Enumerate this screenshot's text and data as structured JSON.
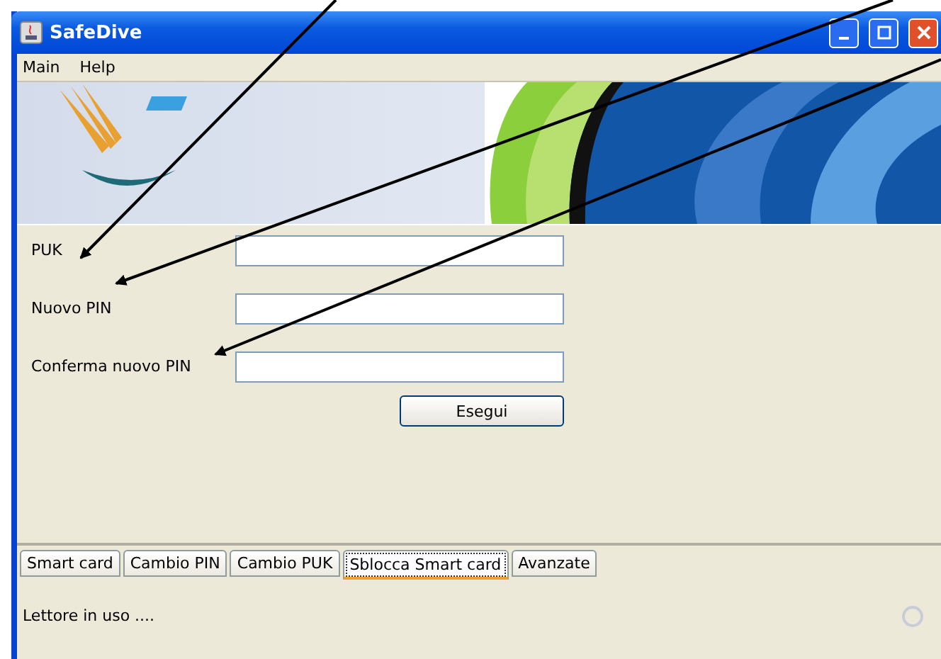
{
  "window": {
    "title": "SafeDive"
  },
  "menu": [
    "Main",
    "Help"
  ],
  "form": {
    "fields": [
      {
        "label": "PUK"
      },
      {
        "label": "Nuovo PIN"
      },
      {
        "label": "Conferma nuovo PIN"
      }
    ],
    "button": "Esegui"
  },
  "tabs": [
    {
      "label": "Smart card",
      "selected": false
    },
    {
      "label": "Cambio PIN",
      "selected": false
    },
    {
      "label": "Cambio PUK",
      "selected": false
    },
    {
      "label": "Sblocca Smart card",
      "selected": true
    },
    {
      "label": "Avanzate",
      "selected": false
    }
  ],
  "status": "Lettore in uso ...."
}
